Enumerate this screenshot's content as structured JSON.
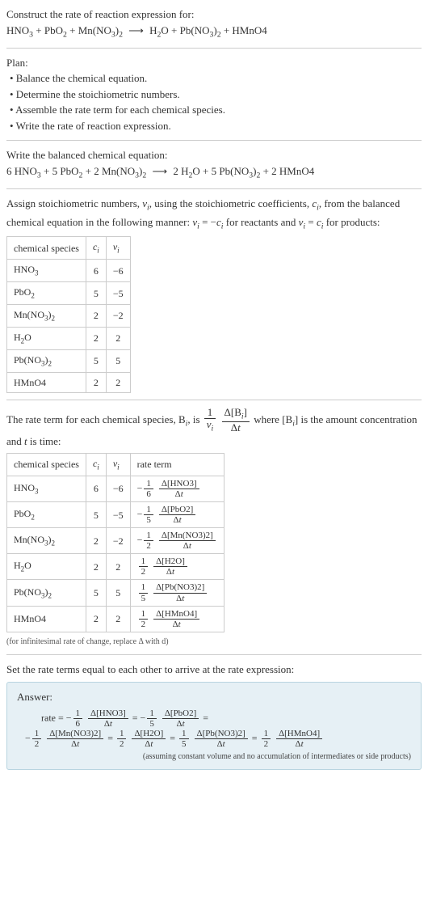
{
  "intro": {
    "construct_label": "Construct the rate of reaction expression for:",
    "eq_lhs_1": "HNO",
    "eq_lhs_plus1": " + ",
    "eq_lhs_2": "PbO",
    "eq_lhs_plus2": " + ",
    "eq_lhs_3": "Mn(NO",
    "eq_lhs_3b": ")",
    "arrow": "⟶",
    "eq_rhs_1": "H",
    "eq_rhs_1b": "O",
    "eq_rhs_plus1": " + ",
    "eq_rhs_2": "Pb(NO",
    "eq_rhs_2b": ")",
    "eq_rhs_plus2": " + ",
    "eq_rhs_3": "HMnO4"
  },
  "plan": {
    "heading": "Plan:",
    "b1": "• Balance the chemical equation.",
    "b2": "• Determine the stoichiometric numbers.",
    "b3": "• Assemble the rate term for each chemical species.",
    "b4": "• Write the rate of reaction expression."
  },
  "balanced": {
    "heading": "Write the balanced chemical equation:",
    "c1": "6 HNO",
    "p1": " + ",
    "c2": "5 PbO",
    "p2": " + ",
    "c3": "2 Mn(NO",
    "c3b": ")",
    "arrow": "⟶",
    "c4": "2 H",
    "c4b": "O",
    "p3": " + ",
    "c5": "5 Pb(NO",
    "c5b": ")",
    "p4": " + ",
    "c6": "2 HMnO4"
  },
  "assign": {
    "t1": "Assign stoichiometric numbers, ",
    "nu": "ν",
    "i": "i",
    "t2": ", using the stoichiometric coefficients, ",
    "c": "c",
    "t3": ", from the balanced chemical equation in the following manner: ",
    "eq1a": " = −",
    "t4": " for reactants and ",
    "eq2a": " = ",
    "t5": " for products:"
  },
  "table1": {
    "h1": "chemical species",
    "h2": "c",
    "h3": "ν",
    "r1s": "HNO",
    "r1c": "6",
    "r1n": "−6",
    "r2s": "PbO",
    "r2c": "5",
    "r2n": "−5",
    "r3s": "Mn(NO",
    "r3sb": ")",
    "r3c": "2",
    "r3n": "−2",
    "r4s": "H",
    "r4sb": "O",
    "r4c": "2",
    "r4n": "2",
    "r5s": "Pb(NO",
    "r5sb": ")",
    "r5c": "5",
    "r5n": "5",
    "r6s": "HMnO4",
    "r6c": "2",
    "r6n": "2"
  },
  "rateterm": {
    "t1": "The rate term for each chemical species, B",
    "t2": ", is ",
    "one": "1",
    "nu_i": "ν",
    "dB": "Δ[B",
    "dBb": "]",
    "dt": "Δt",
    "t3": " where [B",
    "t4": "] is the amount concentration and ",
    "tvar": "t",
    "t5": " is time:"
  },
  "table2": {
    "h1": "chemical species",
    "h2": "c",
    "h3": "ν",
    "h4": "rate term",
    "r1s": "HNO",
    "r1c": "6",
    "r1n": "−6",
    "r1sign": "−",
    "r1fn": "1",
    "r1fd": "6",
    "r1dn": "Δ[HNO3]",
    "r1dd": "Δt",
    "r2s": "PbO",
    "r2c": "5",
    "r2n": "−5",
    "r2sign": "−",
    "r2fn": "1",
    "r2fd": "5",
    "r2dn": "Δ[PbO2]",
    "r2dd": "Δt",
    "r3s": "Mn(NO",
    "r3sb": ")",
    "r3c": "2",
    "r3n": "−2",
    "r3sign": "−",
    "r3fn": "1",
    "r3fd": "2",
    "r3dn": "Δ[Mn(NO3)2]",
    "r3dd": "Δt",
    "r4s": "H",
    "r4sb": "O",
    "r4c": "2",
    "r4n": "2",
    "r4sign": "",
    "r4fn": "1",
    "r4fd": "2",
    "r4dn": "Δ[H2O]",
    "r4dd": "Δt",
    "r5s": "Pb(NO",
    "r5sb": ")",
    "r5c": "5",
    "r5n": "5",
    "r5sign": "",
    "r5fn": "1",
    "r5fd": "5",
    "r5dn": "Δ[Pb(NO3)2]",
    "r5dd": "Δt",
    "r6s": "HMnO4",
    "r6c": "2",
    "r6n": "2",
    "r6sign": "",
    "r6fn": "1",
    "r6fd": "2",
    "r6dn": "Δ[HMnO4]",
    "r6dd": "Δt"
  },
  "note1": "(for infinitesimal rate of change, replace Δ with d)",
  "setequal": "Set the rate terms equal to each other to arrive at the rate expression:",
  "answer": {
    "label": "Answer:",
    "rate": "rate = ",
    "neg": "−",
    "eq": " = ",
    "f1n": "1",
    "f1d": "6",
    "d1n": "Δ[HNO3]",
    "d1d": "Δt",
    "f2n": "1",
    "f2d": "5",
    "d2n": "Δ[PbO2]",
    "d2d": "Δt",
    "f3n": "1",
    "f3d": "2",
    "d3n": "Δ[Mn(NO3)2]",
    "d3d": "Δt",
    "f4n": "1",
    "f4d": "2",
    "d4n": "Δ[H2O]",
    "d4d": "Δt",
    "f5n": "1",
    "f5d": "5",
    "d5n": "Δ[Pb(NO3)2]",
    "d5d": "Δt",
    "f6n": "1",
    "f6d": "2",
    "d6n": "Δ[HMnO4]",
    "d6d": "Δt",
    "note": "(assuming constant volume and no accumulation of intermediates or side products)"
  }
}
